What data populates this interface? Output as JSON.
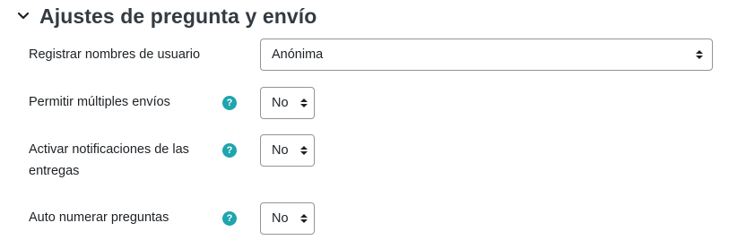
{
  "section": {
    "title": "Ajustes de pregunta y envío",
    "icon": "chevron-down-icon"
  },
  "colors": {
    "help_icon": "#1ea5ad",
    "title": "#333b42",
    "border": "#8f959e"
  },
  "fields": [
    {
      "label": "Registrar nombres de usuario",
      "value": "Anónima",
      "help_icon": false
    },
    {
      "label": "Permitir múltiples envíos",
      "value": "No",
      "help_icon": true
    },
    {
      "label_line1": "Activar notificaciones de las",
      "label_line2": "entregas",
      "value": "No",
      "help_icon": true
    },
    {
      "label": "Auto numerar preguntas",
      "value": "No",
      "help_icon": true
    }
  ],
  "help_glyph": "?"
}
